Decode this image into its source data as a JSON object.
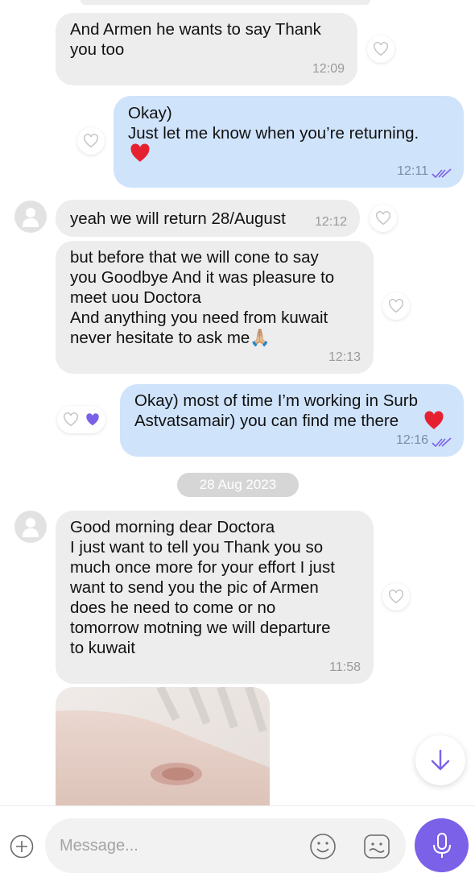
{
  "colors": {
    "incoming_bubble": "#ededed",
    "outgoing_bubble": "#cfe3fb",
    "accent": "#7b61e8",
    "heart_red": "#e6212f",
    "read_ticks": "#7b61e8"
  },
  "messages": [
    {
      "direction": "incoming",
      "text": "And Armen he wants to say Thank\nyou too",
      "time": "12:09"
    },
    {
      "direction": "outgoing",
      "text": "Okay)\nJust let me know when you’re returning.",
      "time": "12:11",
      "emoji": "red-heart",
      "read": true
    },
    {
      "direction": "incoming",
      "text": "yeah we will return 28/August",
      "time": "12:12"
    },
    {
      "direction": "incoming",
      "text": "but before that we will cone to say\nyou Goodbye And it was pleasure to\nmeet uou Doctora\nAnd anything you need from kuwait\nnever hesitate to ask me🙏🏼",
      "time": "12:13"
    },
    {
      "direction": "outgoing",
      "text": "Okay) most of time I’m working in Surb\nAstvatsamair) you can find me there",
      "time": "12:16",
      "emoji": "red-heart",
      "read": true,
      "liked": true
    },
    {
      "direction": "incoming",
      "text": "Good morning dear Doctora\nI just want to tell you Thank you so\nmuch once more for your effort I just\nwant to send you the pic of  Armen\ndoes he need to come or no\ntomorrow motning we will departure\nto kuwait",
      "time": "11:58"
    }
  ],
  "date_separator": "28 Aug 2023",
  "composer": {
    "placeholder": "Message..."
  },
  "icons": {
    "plus": "plus-circle-icon",
    "emoji": "smiley-icon",
    "sticker": "sticker-icon",
    "mic": "microphone-icon",
    "scroll": "arrow-down-icon",
    "like": "heart-outline-icon",
    "avatar": "user-icon"
  }
}
